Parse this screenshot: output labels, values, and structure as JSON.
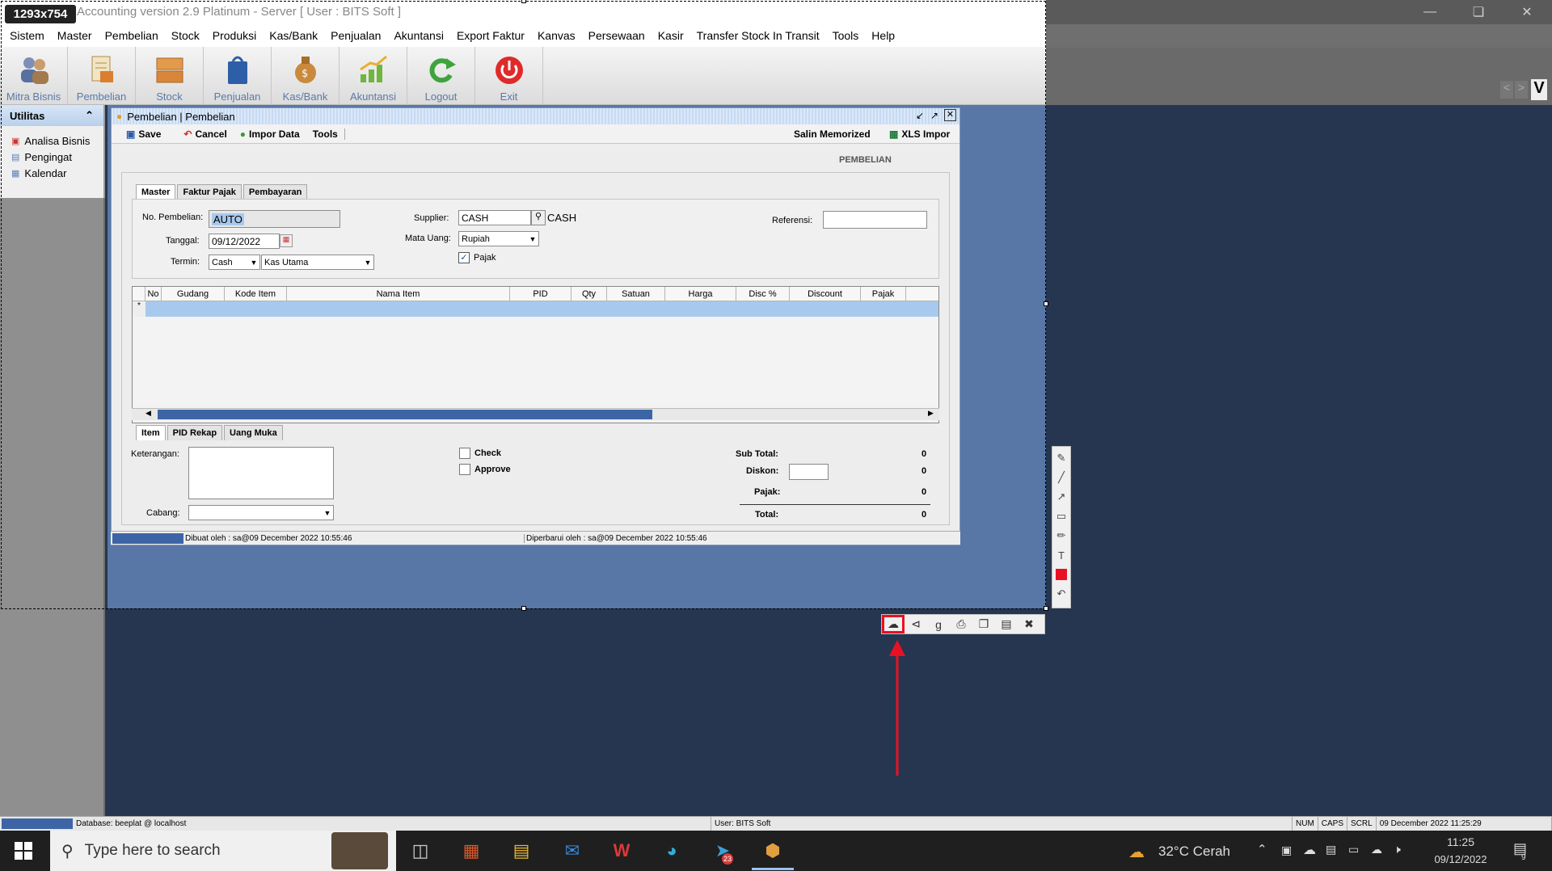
{
  "selection": {
    "dimension_badge": "1293x754"
  },
  "app": {
    "title": "Accounting version 2.9 Platinum - Server  [ User : BITS Soft ]",
    "menu": [
      "Sistem",
      "Master",
      "Pembelian",
      "Stock",
      "Produksi",
      "Kas/Bank",
      "Penjualan",
      "Akuntansi",
      "Export Faktur",
      "Kanvas",
      "Persewaan",
      "Kasir",
      "Transfer Stock In Transit",
      "Tools",
      "Help"
    ],
    "toolbar": [
      {
        "label": "Mitra Bisnis",
        "icon": "users-icon"
      },
      {
        "label": "Pembelian",
        "icon": "purchase-icon"
      },
      {
        "label": "Stock",
        "icon": "boxes-icon"
      },
      {
        "label": "Penjualan",
        "icon": "shopping-bag-icon"
      },
      {
        "label": "Kas/Bank",
        "icon": "money-bag-icon"
      },
      {
        "label": "Akuntansi",
        "icon": "chart-growth-icon"
      },
      {
        "label": "Logout",
        "icon": "refresh-icon"
      },
      {
        "label": "Exit",
        "icon": "power-icon"
      }
    ],
    "right_nav": {
      "prev": "<",
      "next": ">",
      "v": "V"
    }
  },
  "utilitas": {
    "title": "Utilitas",
    "items": [
      "Analisa Bisnis",
      "Pengingat",
      "Kalendar"
    ]
  },
  "form": {
    "title": "Pembelian | Pembelian",
    "toolbar": {
      "save": "Save",
      "cancel": "Cancel",
      "impor": "Impor Data",
      "tools": "Tools",
      "salin": "Salin Memorized",
      "xls": "XLS Impor"
    },
    "heading": "PEMBELIAN",
    "tabs": [
      "Master",
      "Faktur Pajak",
      "Pembayaran"
    ],
    "fields": {
      "no_pembelian_label": "No. Pembelian:",
      "no_pembelian": "AUTO",
      "tanggal_label": "Tanggal:",
      "tanggal": "09/12/2022",
      "termin_label": "Termin:",
      "termin": "Cash",
      "kas": "Kas Utama",
      "supplier_label": "Supplier:",
      "supplier": "CASH",
      "supplier_name": "CASH",
      "mata_uang_label": "Mata Uang:",
      "mata_uang": "Rupiah",
      "pajak_label": "Pajak",
      "referensi_label": "Referensi:",
      "referensi": ""
    },
    "grid": {
      "columns": [
        "No",
        "Gudang",
        "Kode Item",
        "Nama Item",
        "PID",
        "Qty",
        "Satuan",
        "Harga",
        "Disc %",
        "Discount",
        "Pajak"
      ],
      "row_marker": "*"
    },
    "bottom_tabs": [
      "Item",
      "PID Rekap",
      "Uang Muka"
    ],
    "footer": {
      "keterangan_label": "Keterangan:",
      "cabang_label": "Cabang:",
      "check_label": "Check",
      "approve_label": "Approve",
      "subtotal_label": "Sub Total:",
      "subtotal": "0",
      "diskon_label": "Diskon:",
      "diskon": "0",
      "pajak_label": "Pajak:",
      "pajak": "0",
      "total_label": "Total:",
      "total": "0"
    },
    "status": {
      "dibuat": "Dibuat oleh : sa@09 December 2022  10:55:46",
      "diperbarui": "Diperbarui oleh : sa@09 December 2022  10:55:46"
    }
  },
  "statusbar": {
    "database": "Database: beeplat @ localhost",
    "user": "User: BITS Soft",
    "num": "NUM",
    "caps": "CAPS",
    "scrl": "SCRL",
    "datetime": "09 December 2022  11:25:29"
  },
  "taskbar": {
    "search_placeholder": "Type here to search",
    "weather": "32°C  Cerah",
    "time": "11:25",
    "date": "09/12/2022",
    "mail_badge": "23",
    "notif_badge": "9"
  },
  "colors": {
    "accent": "#3d65a6",
    "highlight": "#e81123"
  }
}
